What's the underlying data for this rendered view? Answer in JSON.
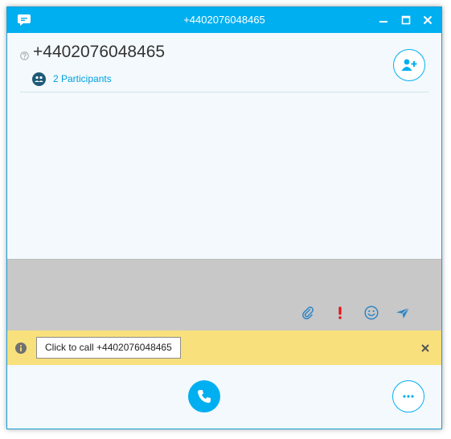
{
  "window": {
    "title": "+4402076048465",
    "icons": {
      "app": "skype-chat-icon",
      "minimize": "minimize-icon",
      "maximize": "maximize-icon",
      "close": "close-icon"
    }
  },
  "conversation": {
    "contact_name": "+4402076048465",
    "participants_label": "2 Participants",
    "icons": {
      "status": "help-status-icon",
      "participants": "participants-icon",
      "add_people": "add-people-icon"
    }
  },
  "compose": {
    "icons": [
      "attach-file-icon",
      "urgent-icon",
      "emoji-icon",
      "send-icon"
    ]
  },
  "notification": {
    "text": "Click to call +4402076048465",
    "icons": {
      "info": "info-icon",
      "close": "dismiss-icon"
    }
  },
  "call_controls": {
    "icons": {
      "call": "phone-icon",
      "more": "more-options-icon"
    }
  },
  "colors": {
    "accent": "#00aff0",
    "window_bg": "#f3f9fc",
    "compose_bg": "#c8c8c8",
    "notification_bg": "#f8e17c",
    "urgent": "#e0151b"
  }
}
